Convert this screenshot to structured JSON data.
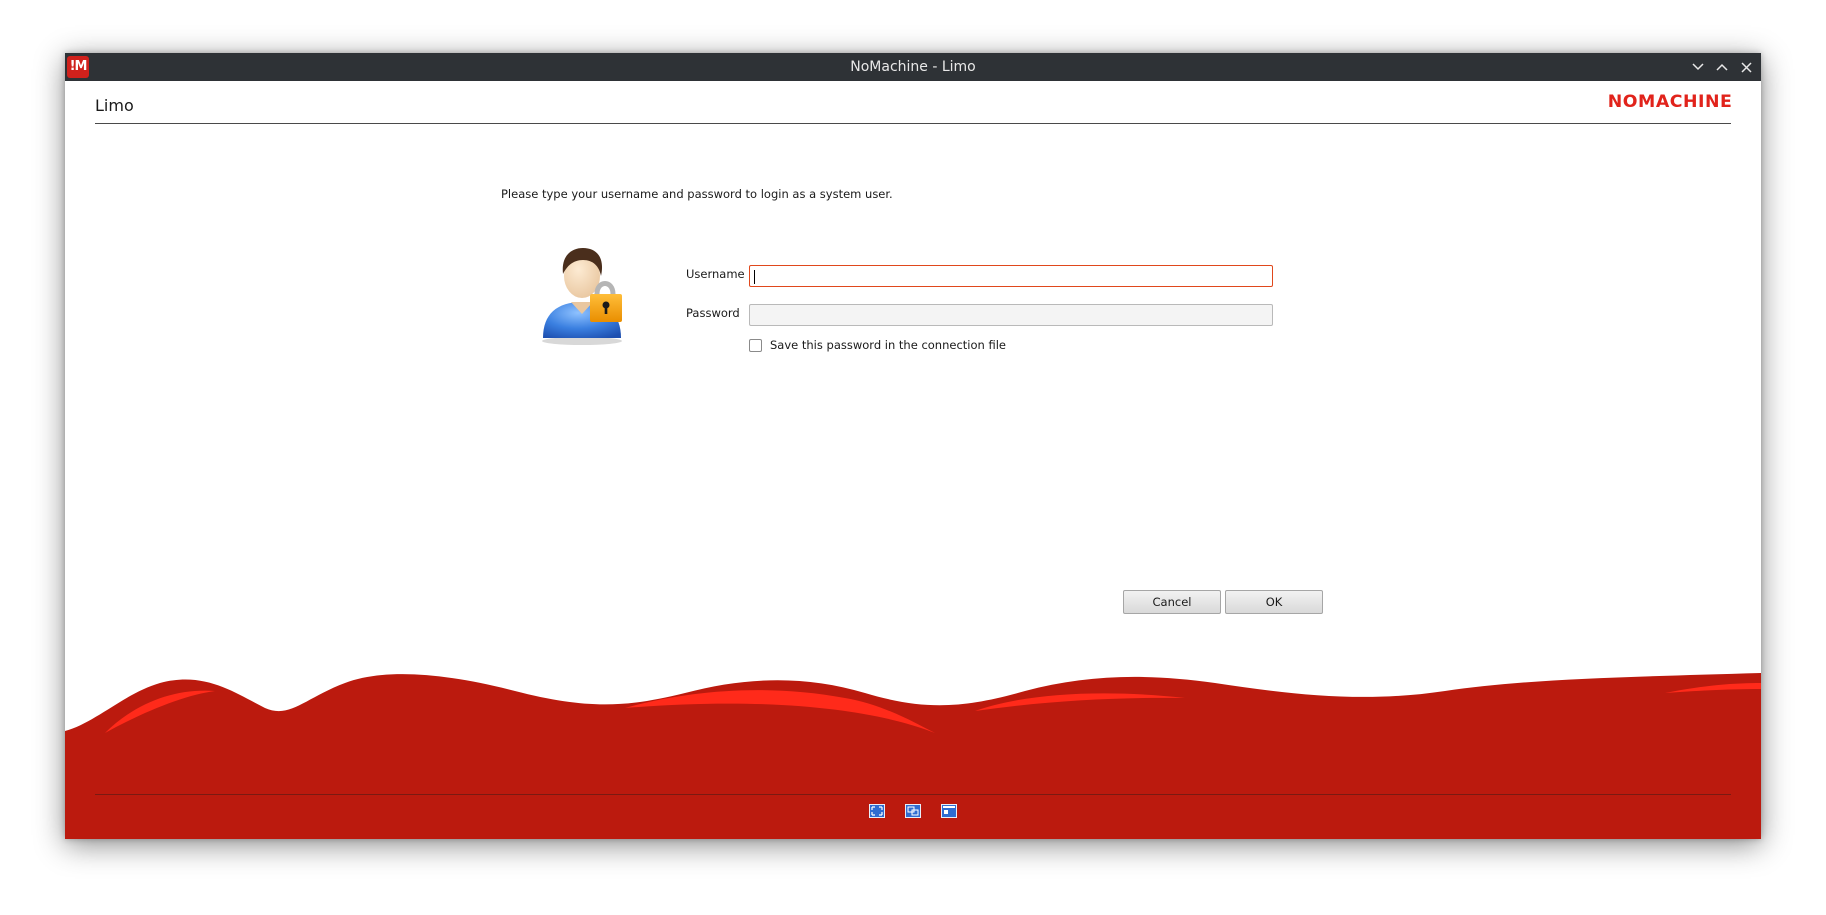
{
  "window": {
    "title": "NoMachine - Limo",
    "app_icon_text": "!M"
  },
  "header": {
    "title": "Limo",
    "brand": "NOMACHINE"
  },
  "login": {
    "instruction": "Please type your username and password to login as a system user.",
    "username_label": "Username",
    "username_value": "",
    "password_label": "Password",
    "password_value": "",
    "save_password_label": "Save this password in the connection file",
    "save_password_checked": false
  },
  "buttons": {
    "cancel": "Cancel",
    "ok": "OK"
  },
  "footer": {
    "icons": [
      "fullscreen-icon",
      "display-settings-icon",
      "window-icon"
    ]
  },
  "colors": {
    "brand_red": "#e1231b",
    "footer_red": "#bb1a0e",
    "titlebar": "#2e3236",
    "focus_border": "#e0481c"
  }
}
